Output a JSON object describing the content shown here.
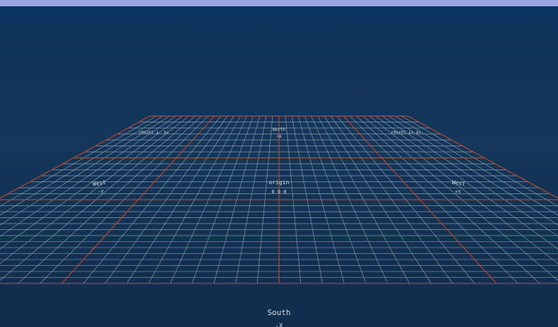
{
  "scene": {
    "labels": {
      "origin_title": "origin",
      "origin_coords": "0 0 0",
      "north_title": "North",
      "north_axis": "+X",
      "west_title": "West",
      "west_axis": "-Y",
      "east_title": "West",
      "east_axis": "+Y",
      "south_title": "South",
      "south_axis": "-X",
      "corner_left": "+X -Y corner",
      "corner_right": "+X +Y corner"
    },
    "colors": {
      "top_bar": "#9aa6e0",
      "sky_top": "#0a3563",
      "sky_bottom": "#102d4c",
      "grid_fine": "#8a98a8",
      "grid_major": "#c0442a",
      "label_text": "#d6dde6"
    },
    "grid": {
      "fine_divisions": 40,
      "major_every": 10
    }
  }
}
